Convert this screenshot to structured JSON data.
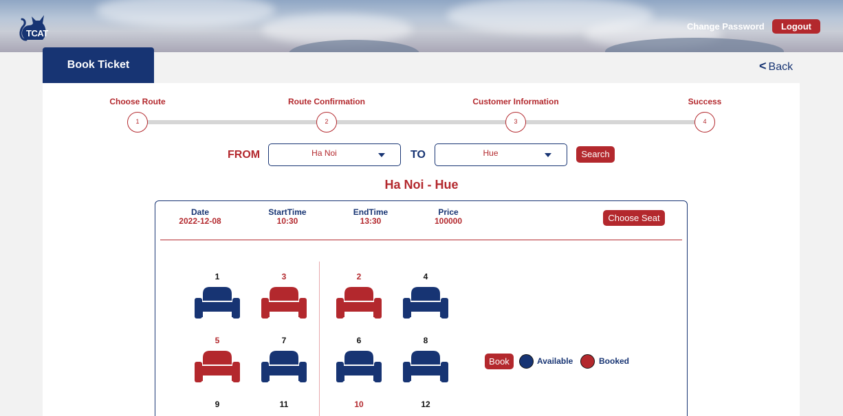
{
  "header": {
    "logo_text": "TCAT",
    "change_password_label": "Change Password",
    "logout_label": "Logout"
  },
  "tab": {
    "label": "Book Ticket"
  },
  "back": {
    "label": "Back"
  },
  "steps": [
    {
      "label": "Choose Route",
      "number": "1"
    },
    {
      "label": "Route Confirmation",
      "number": "2"
    },
    {
      "label": "Customer Information",
      "number": "3"
    },
    {
      "label": "Success",
      "number": "4"
    }
  ],
  "search": {
    "from_label": "FROM",
    "from_value": "Ha Noi",
    "to_label": "TO",
    "to_value": "Hue",
    "button_label": "Search"
  },
  "route_title": "Ha Noi - Hue",
  "trip": {
    "date_label": "Date",
    "date": "2022-12-08",
    "start_label": "StartTime",
    "start": "10:30",
    "end_label": "EndTime",
    "end": "13:30",
    "price_label": "Price",
    "price": "100000",
    "choose_seat_label": "Choose Seat"
  },
  "seats": [
    {
      "number": "1",
      "status": "available"
    },
    {
      "number": "3",
      "status": "booked"
    },
    {
      "number": "2",
      "status": "booked"
    },
    {
      "number": "4",
      "status": "available"
    },
    {
      "number": "5",
      "status": "booked"
    },
    {
      "number": "7",
      "status": "available"
    },
    {
      "number": "6",
      "status": "available"
    },
    {
      "number": "8",
      "status": "available"
    },
    {
      "number": "9",
      "status": "available"
    },
    {
      "number": "11",
      "status": "available"
    },
    {
      "number": "10",
      "status": "booked"
    },
    {
      "number": "12",
      "status": "available"
    }
  ],
  "legend": {
    "book_label": "Book",
    "available_label": "Available",
    "booked_label": "Booked"
  },
  "colors": {
    "navy": "#173473",
    "red": "#b3282d",
    "available": "#173473",
    "booked": "#b3282d"
  }
}
